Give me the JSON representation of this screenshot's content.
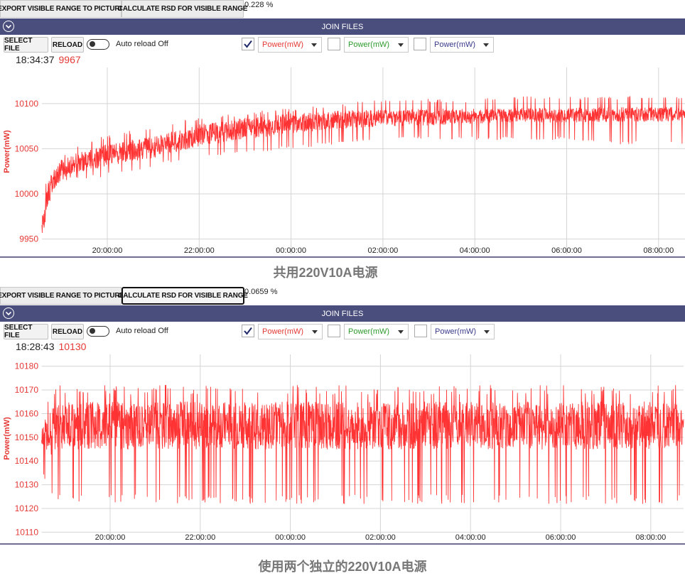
{
  "panels": [
    {
      "toolbar": {
        "export_label": "EXPORT VISIBLE RANGE TO PICTURE",
        "rsd_label": "CALCULATE RSD FOR VISIBLE RANGE",
        "rsd_value": "0.228 %",
        "rsd_active": false
      },
      "bar_title": "JOIN FILES",
      "controls": {
        "select_file_label": "SELECT FILE",
        "reload_label": "RELOAD",
        "auto_reload_label": "Auto reload Off",
        "channels": [
          {
            "checked": true,
            "label": "Power(mW)",
            "color": "#e53935"
          },
          {
            "checked": false,
            "label": "Power(mW)",
            "color": "#2e9a2e"
          },
          {
            "checked": false,
            "label": "Power(mW)",
            "color": "#3a3a8c"
          }
        ]
      },
      "readout": {
        "time": "18:34:37",
        "value": "9967"
      },
      "caption": "共用220V10A电源",
      "chart_data": {
        "type": "line",
        "ylabel": "Power(mW)",
        "color": "#ff3333",
        "x_ticks": [
          "20:00:00",
          "22:00:00",
          "00:00:00",
          "02:00:00",
          "04:00:00",
          "06:00:00",
          "08:00:00"
        ],
        "y_ticks": [
          9950,
          10000,
          10050,
          10100
        ],
        "ylim": [
          9930,
          10140
        ],
        "xlim": [
          "18:34:37",
          "08:40:00"
        ],
        "trend": {
          "hours_from_20": [
            -1.4,
            -1.3,
            -1.1,
            -0.9,
            -0.6,
            0.0,
            1.0,
            2.0,
            3.0,
            4.0,
            5.0,
            6.0,
            7.0,
            8.0,
            9.0,
            10.0,
            11.0,
            12.0,
            12.7
          ],
          "mean": [
            9965,
            10000,
            10022,
            10030,
            10035,
            10043,
            10052,
            10065,
            10072,
            10078,
            10082,
            10084,
            10085,
            10086,
            10087,
            10087,
            10088,
            10088,
            10088
          ],
          "noise": [
            12,
            14,
            12,
            11,
            11,
            12,
            12,
            12,
            12,
            11,
            10,
            9,
            9,
            8,
            8,
            8,
            8,
            8,
            8
          ],
          "spike_low": [
            9948,
            9985,
            10010,
            10015,
            10015,
            10020,
            10030,
            10040,
            10045,
            10050,
            10055,
            10060,
            10060,
            10060,
            10060,
            10060,
            10055,
            10055,
            10055
          ],
          "spike_high": [
            9985,
            10030,
            10040,
            10045,
            10055,
            10065,
            10075,
            10085,
            10090,
            10095,
            10100,
            10105,
            10105,
            10105,
            10108,
            10108,
            10108,
            10108,
            10108
          ]
        }
      }
    },
    {
      "toolbar": {
        "export_label": "EXPORT VISIBLE RANGE TO PICTURE",
        "rsd_label": "CALCULATE RSD FOR VISIBLE RANGE",
        "rsd_value": "0.0659 %",
        "rsd_active": true
      },
      "bar_title": "JOIN FILES",
      "controls": {
        "select_file_label": "SELECT FILE",
        "reload_label": "RELOAD",
        "auto_reload_label": "Auto reload Off",
        "channels": [
          {
            "checked": true,
            "label": "Power(mW)",
            "color": "#e53935"
          },
          {
            "checked": false,
            "label": "Power(mW)",
            "color": "#2e9a2e"
          },
          {
            "checked": false,
            "label": "Power(mW)",
            "color": "#3a3a8c"
          }
        ]
      },
      "readout": {
        "time": "18:28:43",
        "value": "10130"
      },
      "caption": "使用两个独立的220V10A电源",
      "chart_data": {
        "type": "line",
        "ylabel": "Power(mW)",
        "color": "#ff3333",
        "x_ticks": [
          "20:00:00",
          "22:00:00",
          "00:00:00",
          "02:00:00",
          "04:00:00",
          "06:00:00",
          "08:00:00"
        ],
        "y_ticks": [
          10110,
          10120,
          10130,
          10140,
          10150,
          10160,
          10170,
          10180
        ],
        "ylim": [
          10105,
          10185
        ],
        "xlim": [
          "18:28:43",
          "08:40:00"
        ],
        "trend": {
          "hours_from_20": [
            -1.5,
            -1.3,
            -1.2,
            0.0,
            12.7
          ],
          "mean": [
            10150,
            10152,
            10155,
            10155,
            10155
          ],
          "noise": [
            4,
            10,
            10,
            10,
            10
          ],
          "spike_low": [
            10135,
            10124,
            10122,
            10122,
            10122
          ],
          "spike_high": [
            10155,
            10172,
            10172,
            10172,
            10172
          ]
        }
      }
    }
  ]
}
